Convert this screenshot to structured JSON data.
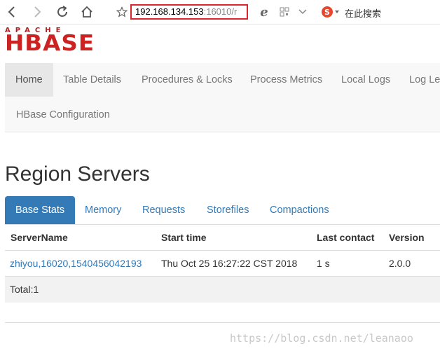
{
  "browser": {
    "address_host": "192.168.134.153",
    "address_port": ":16010/r",
    "search_placeholder": "在此搜索",
    "icons": [
      "back-icon",
      "forward-icon",
      "refresh-icon",
      "home-icon",
      "star-icon",
      "ie-icon",
      "qr-icon",
      "chevron-down-icon",
      "sogou-icon"
    ]
  },
  "logo": {
    "top": "APACHE",
    "main": "HBASE"
  },
  "nav": {
    "items": [
      "Home",
      "Table Details",
      "Procedures & Locks",
      "Process Metrics",
      "Local Logs",
      "Log Le",
      "HBase Configuration"
    ],
    "active": "Home"
  },
  "page": {
    "title": "Region Servers"
  },
  "tabs": {
    "items": [
      "Base Stats",
      "Memory",
      "Requests",
      "Storefiles",
      "Compactions"
    ],
    "active": "Base Stats"
  },
  "table": {
    "headers": [
      "ServerName",
      "Start time",
      "Last contact",
      "Version"
    ],
    "rows": [
      {
        "server": "zhiyou,16020,1540456042193",
        "start": "Thu Oct 25 16:27:22 CST 2018",
        "contact": "1 s",
        "version": "2.0.0"
      }
    ],
    "total": "Total:1"
  },
  "watermark": "https://blog.csdn.net/leanaoo",
  "colors": {
    "accent": "#337ab7",
    "logo_red": "#cc2222",
    "highlight_border": "#d9262c"
  }
}
